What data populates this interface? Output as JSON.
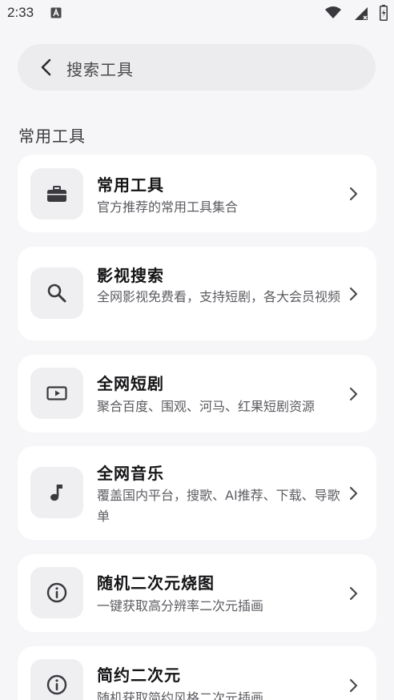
{
  "status_bar": {
    "time": "2:33"
  },
  "search_bar": {
    "label": "搜索工具"
  },
  "section": {
    "title": "常用工具"
  },
  "tools": [
    {
      "title": "常用工具",
      "desc": "官方推荐的常用工具集合",
      "icon": "briefcase-icon"
    },
    {
      "title": "影视搜索",
      "desc": "全网影视免费看，支持短剧，各大会员视频",
      "icon": "search-icon"
    },
    {
      "title": "全网短剧",
      "desc": "聚合百度、围观、河马、红果短剧资源",
      "icon": "video-play-icon"
    },
    {
      "title": "全网音乐",
      "desc": "覆盖国内平台，搜歌、AI推荐、下载、导歌单",
      "icon": "music-note-icon"
    },
    {
      "title": "随机二次元烧图",
      "desc": "一键获取高分辨率二次元插画",
      "icon": "info-icon"
    },
    {
      "title": "简约二次元",
      "desc": "随机获取简约风格二次元插画",
      "icon": "info-icon"
    }
  ],
  "colors": {
    "background": "#f6f6f8",
    "card": "#ffffff",
    "icon_box": "#efeff2",
    "search_bar": "#ececee"
  }
}
